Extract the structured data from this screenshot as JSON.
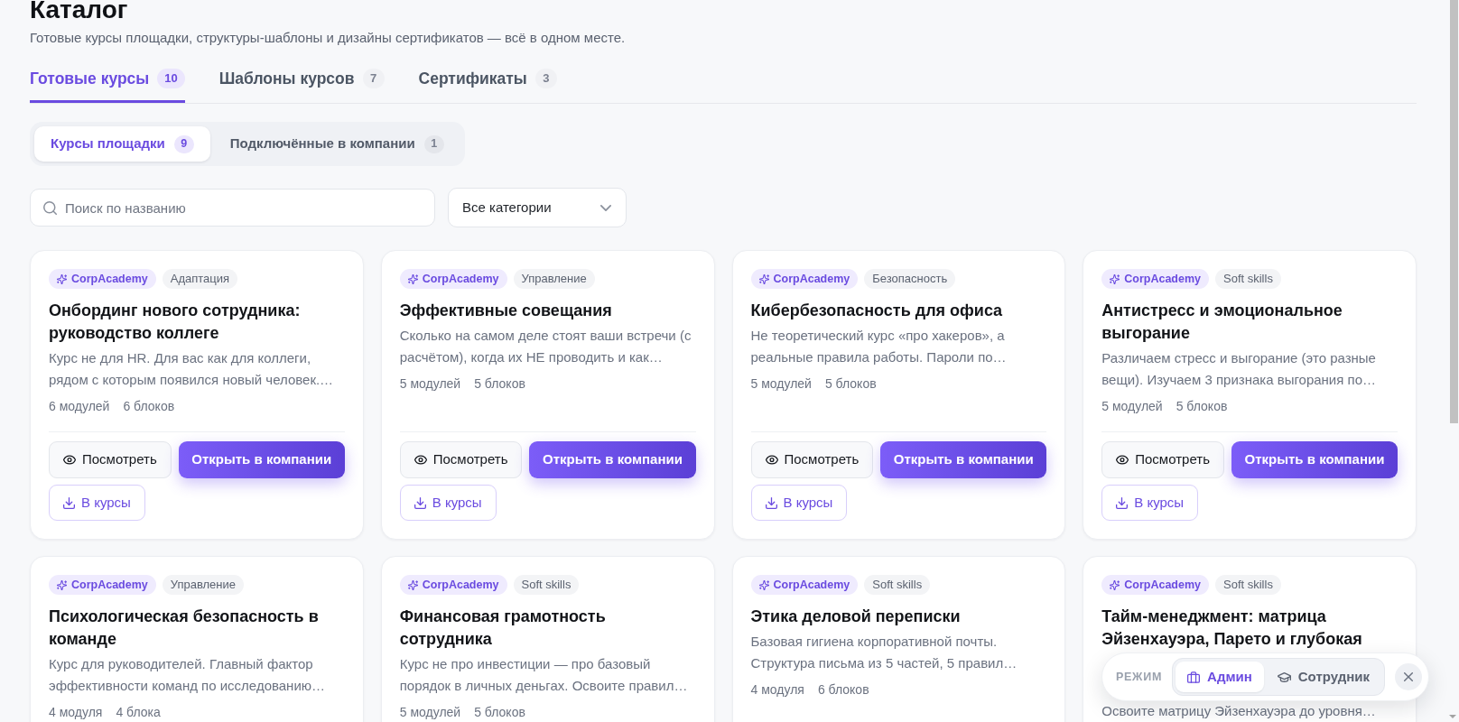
{
  "header": {
    "title": "Каталог",
    "subtitle": "Готовые курсы площадки, структуры-шаблоны и дизайны сертификатов — всё в одном месте."
  },
  "tabs": [
    {
      "label": "Готовые курсы",
      "count": "10",
      "selected": true
    },
    {
      "label": "Шаблоны курсов",
      "count": "7",
      "selected": false
    },
    {
      "label": "Сертификаты",
      "count": "3",
      "selected": false
    }
  ],
  "subtabs": [
    {
      "label": "Курсы площадки",
      "count": "9",
      "selected": true
    },
    {
      "label": "Подключённые в компании",
      "count": "1",
      "selected": false
    }
  ],
  "search": {
    "placeholder": "Поиск по названию"
  },
  "category_filter": {
    "value": "Все категории"
  },
  "courses": [
    {
      "provider": "CorpAcademy",
      "category": "Адаптация",
      "title": "Онбординг нового сотрудника: руководство коллеге",
      "description": "Курс не для HR. Для вас как для коллеги, рядом с которым появился новый человек.…",
      "meta": [
        "6 модулей",
        "6 блоков"
      ],
      "actions": [
        {
          "kind": "view",
          "label": "Посмотреть"
        },
        {
          "kind": "open",
          "label": "Открыть в компании"
        },
        {
          "kind": "add",
          "label": "В курсы"
        }
      ]
    },
    {
      "provider": "CorpAcademy",
      "category": "Управление",
      "title": "Эффективные совещания",
      "description": "Сколько на самом деле стоят ваши встречи (с расчётом), когда их НЕ проводить и как…",
      "meta": [
        "5 модулей",
        "5 блоков"
      ],
      "actions": [
        {
          "kind": "view",
          "label": "Посмотреть"
        },
        {
          "kind": "open",
          "label": "Открыть в компании"
        },
        {
          "kind": "add",
          "label": "В курсы"
        }
      ]
    },
    {
      "provider": "CorpAcademy",
      "category": "Безопасность",
      "title": "Кибербезопасность для офиса",
      "description": "Не теоретический курс «про хакеров», а реальные правила работы. Пароли по…",
      "meta": [
        "5 модулей",
        "5 блоков"
      ],
      "actions": [
        {
          "kind": "view",
          "label": "Посмотреть"
        },
        {
          "kind": "open",
          "label": "Открыть в компании"
        },
        {
          "kind": "add",
          "label": "В курсы"
        }
      ]
    },
    {
      "provider": "CorpAcademy",
      "category": "Soft skills",
      "title": "Антистресс и эмоциональное выгорание",
      "description": "Различаем стресс и выгорание (это разные вещи). Изучаем 3 признака выгорания по…",
      "meta": [
        "5 модулей",
        "5 блоков"
      ],
      "actions": [
        {
          "kind": "view",
          "label": "Посмотреть"
        },
        {
          "kind": "open",
          "label": "Открыть в компании"
        },
        {
          "kind": "add",
          "label": "В курсы"
        }
      ]
    },
    {
      "provider": "CorpAcademy",
      "category": "Управление",
      "title": "Психологическая безопасность в команде",
      "description": "Курс для руководителей. Главный фактор эффективности команд по исследованию…",
      "meta": [
        "4 модуля",
        "4 блока"
      ]
    },
    {
      "provider": "CorpAcademy",
      "category": "Soft skills",
      "title": "Финансовая грамотность сотрудника",
      "description": "Курс не про инвестиции — про базовый порядок в личных деньгах. Освоите правил…",
      "meta": [
        "5 модулей",
        "5 блоков"
      ]
    },
    {
      "provider": "CorpAcademy",
      "category": "Soft skills",
      "title": "Этика деловой переписки",
      "description": "Базовая гигиена корпоративной почты. Структура письма из 5 частей, 5 правил…",
      "meta": [
        "4 модуля",
        "6 блоков"
      ]
    },
    {
      "provider": "CorpAcademy",
      "category": "Soft skills",
      "title": "Тайм-менеджмент: матрица Эйзенхауэра, Парето и глубокая",
      "description": "Освоите матрицу Эйзенхауэра до уровня…"
    }
  ],
  "mode_switcher": {
    "label": "РЕЖИМ",
    "options": [
      {
        "label": "Админ",
        "selected": true
      },
      {
        "label": "Сотрудник",
        "selected": false
      }
    ]
  }
}
